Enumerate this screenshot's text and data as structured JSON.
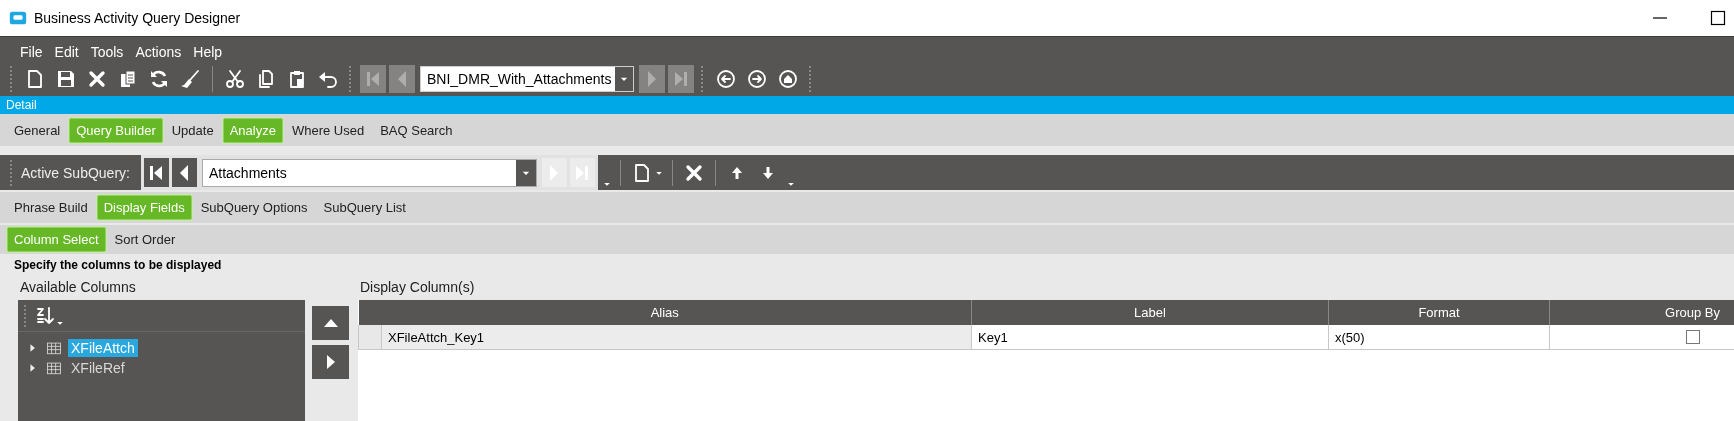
{
  "window": {
    "title": "Business Activity Query Designer"
  },
  "menu": [
    "File",
    "Edit",
    "Tools",
    "Actions",
    "Help"
  ],
  "toolbar": {
    "query_id": "BNI_DMR_With_Attachments"
  },
  "detail_bar": {
    "title": "Detail"
  },
  "tabs": [
    {
      "label": "General",
      "selected": false
    },
    {
      "label": "Query Builder",
      "selected": true
    },
    {
      "label": "Update",
      "selected": false
    },
    {
      "label": "Analyze",
      "selected": true
    },
    {
      "label": "Where Used",
      "selected": false
    },
    {
      "label": "BAQ Search",
      "selected": false
    }
  ],
  "subquery": {
    "label": "Active SubQuery:",
    "value": "Attachments"
  },
  "subquery_tabs": [
    {
      "label": "Phrase Build",
      "selected": false
    },
    {
      "label": "Display Fields",
      "selected": true
    },
    {
      "label": "SubQuery Options",
      "selected": false
    },
    {
      "label": "SubQuery List",
      "selected": false
    }
  ],
  "display_tabs": [
    {
      "label": "Column Select",
      "selected": true
    },
    {
      "label": "Sort Order",
      "selected": false
    }
  ],
  "instruction": "Specify the columns to be displayed",
  "available_columns": {
    "title": "Available Columns",
    "tables": [
      {
        "label": "XFileAttch",
        "selected": true
      },
      {
        "label": "XFileRef",
        "selected": false
      }
    ]
  },
  "display_columns": {
    "title": "Display Column(s)",
    "columns": [
      "Alias",
      "Label",
      "Format",
      "Group By"
    ],
    "rows": [
      {
        "alias": "XFileAttch_Key1",
        "label": "Key1",
        "format": "x(50)",
        "group_by": false
      }
    ]
  }
}
